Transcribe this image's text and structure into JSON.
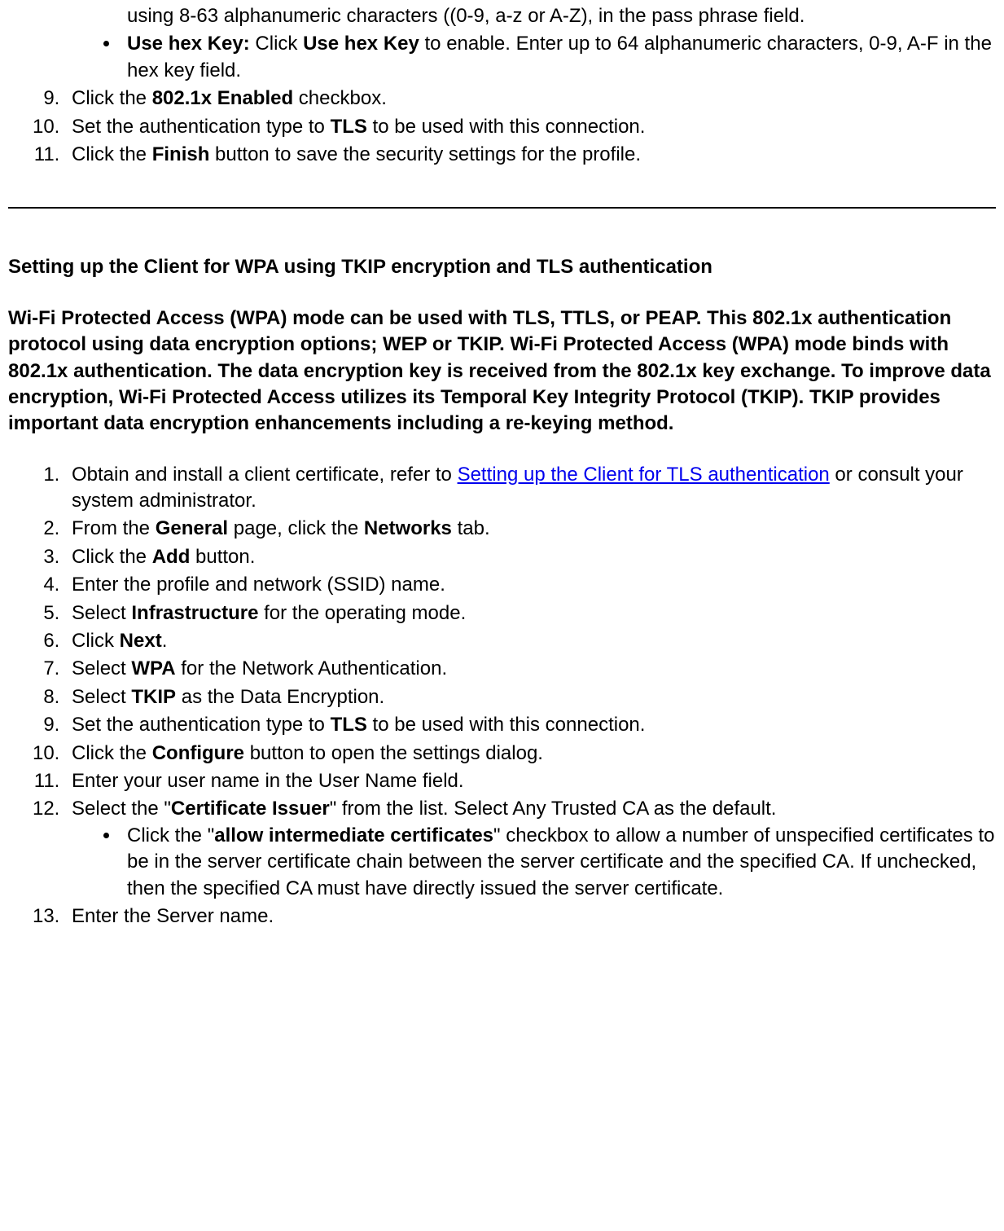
{
  "topList": {
    "bullet_pre": "using 8-63 alphanumeric characters ((0-9, a-z or A-Z), in the pass phrase field.",
    "bullet2_b1": "Use hex Key:",
    "bullet2_mid": " Click ",
    "bullet2_b2": "Use hex Key",
    "bullet2_tail": " to enable. Enter up to 64 alphanumeric characters, 0-9, A-F in the hex key field.",
    "item9_a": "Click the ",
    "item9_b": "802.1x Enabled",
    "item9_c": " checkbox.",
    "item10_a": "Set the authentication type to ",
    "item10_b": "TLS",
    "item10_c": " to be used with this connection.",
    "item11_a": "Click the ",
    "item11_b": "Finish",
    "item11_c": " button to save the security settings for the profile."
  },
  "section": {
    "heading": "Setting up the Client for WPA using TKIP encryption and TLS authentication",
    "intro": "Wi-Fi Protected Access (WPA) mode can be used with TLS, TTLS, or PEAP. This 802.1x authentication protocol using data encryption options; WEP or TKIP. Wi-Fi Protected Access (WPA) mode binds with 802.1x authentication. The data encryption key is received from the 802.1x key exchange. To improve data encryption, Wi-Fi Protected Access utilizes its Temporal Key Integrity Protocol (TKIP). TKIP provides important data encryption enhancements including a re-keying method."
  },
  "steps": {
    "s1_a": "Obtain and install a client certificate, refer to ",
    "s1_link": "Setting up the Client for TLS authentication",
    "s1_c": " or consult your system administrator.",
    "s2_a": "From the ",
    "s2_b": "General",
    "s2_c": " page, click the ",
    "s2_d": "Networks",
    "s2_e": " tab.",
    "s3_a": "Click the ",
    "s3_b": "Add",
    "s3_c": " button.",
    "s4": "Enter the profile and network (SSID) name.",
    "s5_a": "Select ",
    "s5_b": "Infrastructure",
    "s5_c": " for the operating mode.",
    "s6_a": "Click ",
    "s6_b": "Next",
    "s6_c": ".",
    "s7_a": "Select ",
    "s7_b": "WPA",
    "s7_c": " for the Network Authentication.",
    "s8_a": "Select ",
    "s8_b": "TKIP",
    "s8_c": " as the Data Encryption.",
    "s9_a": "Set the authentication type to ",
    "s9_b": "TLS",
    "s9_c": " to be used with this connection.",
    "s10_a": "Click the ",
    "s10_b": "Configure",
    "s10_c": " button to open the settings dialog.",
    "s11": "Enter your user name in the User Name field.",
    "s12_a": "Select the \"",
    "s12_b": "Certificate Issuer",
    "s12_c": "\" from the list. Select Any Trusted CA as the default.",
    "s12_sub_a": "Click the \"",
    "s12_sub_b": "allow intermediate certificates",
    "s12_sub_c": "\" checkbox to allow a number of unspecified certificates to be in the server certificate chain between the server certificate and the specified CA. If unchecked, then the specified CA must have directly issued the server certificate.",
    "s13": "Enter the Server name."
  }
}
